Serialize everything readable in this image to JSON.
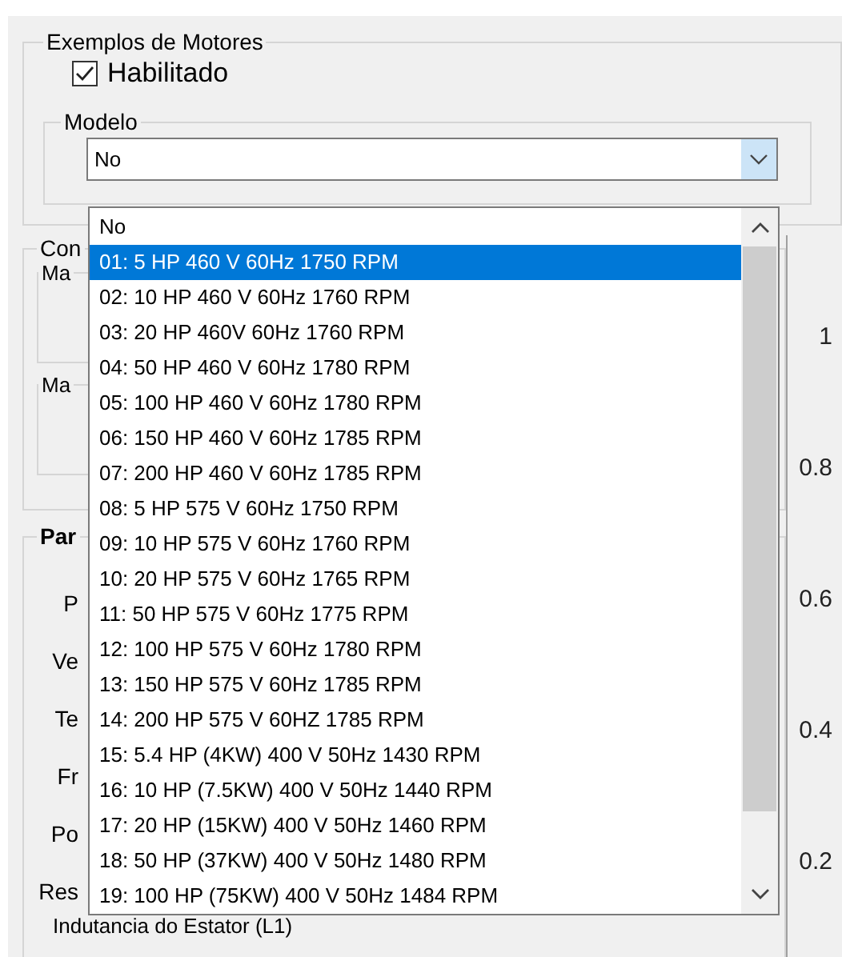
{
  "motor_examples": {
    "title": "Exemplos de Motores",
    "enabled": {
      "label": "Habilitado",
      "checked": true
    },
    "model": {
      "title": "Modelo",
      "value": "No",
      "open": true
    }
  },
  "dropdown": {
    "items": [
      {
        "label": "No",
        "selected": false
      },
      {
        "label": "01: 5 HP 460 V 60Hz 1750 RPM",
        "selected": true
      },
      {
        "label": "02: 10 HP 460 V 60Hz 1760 RPM",
        "selected": false
      },
      {
        "label": "03: 20 HP 460V 60Hz 1760 RPM",
        "selected": false
      },
      {
        "label": "04: 50 HP 460 V 60Hz 1780 RPM",
        "selected": false
      },
      {
        "label": "05: 100 HP 460 V 60Hz 1780 RPM",
        "selected": false
      },
      {
        "label": "06: 150 HP 460 V 60Hz 1785 RPM",
        "selected": false
      },
      {
        "label": "07: 200 HP 460 V 60Hz 1785 RPM",
        "selected": false
      },
      {
        "label": "08: 5 HP 575 V 60Hz 1750 RPM",
        "selected": false
      },
      {
        "label": "09: 10 HP 575 V 60Hz 1760 RPM",
        "selected": false
      },
      {
        "label": "10: 20 HP 575 V 60Hz 1765 RPM",
        "selected": false
      },
      {
        "label": "11: 50 HP 575 V 60Hz 1775 RPM",
        "selected": false
      },
      {
        "label": "12: 100 HP 575 V 60Hz 1780 RPM",
        "selected": false
      },
      {
        "label": "13: 150 HP 575 V 60Hz 1785 RPM",
        "selected": false
      },
      {
        "label": "14: 200 HP 575 V 60HZ 1785 RPM",
        "selected": false
      },
      {
        "label": "15: 5.4 HP (4KW) 400 V 50Hz 1430 RPM",
        "selected": false
      },
      {
        "label": "16: 10 HP (7.5KW) 400 V 50Hz 1440 RPM",
        "selected": false
      },
      {
        "label": "17: 20 HP (15KW) 400 V 50Hz 1460 RPM",
        "selected": false
      },
      {
        "label": "18: 50 HP (37KW) 400 V 50Hz 1480 RPM",
        "selected": false
      },
      {
        "label": "19: 100 HP (75KW) 400 V 50Hz 1484 RPM",
        "selected": false
      }
    ]
  },
  "background": {
    "control_group": {
      "title": "Con",
      "subgroups": [
        "Ma",
        "Ma"
      ]
    },
    "parameters_group": {
      "title": "Par",
      "labels": [
        "P",
        "Ve",
        "Te",
        "Fr",
        "Po",
        "Res"
      ],
      "bottom_label": "Indutancia do Estator (L1)"
    },
    "axis_ticks": [
      "1",
      "0.8",
      "0.6",
      "0.4",
      "0.2"
    ]
  }
}
